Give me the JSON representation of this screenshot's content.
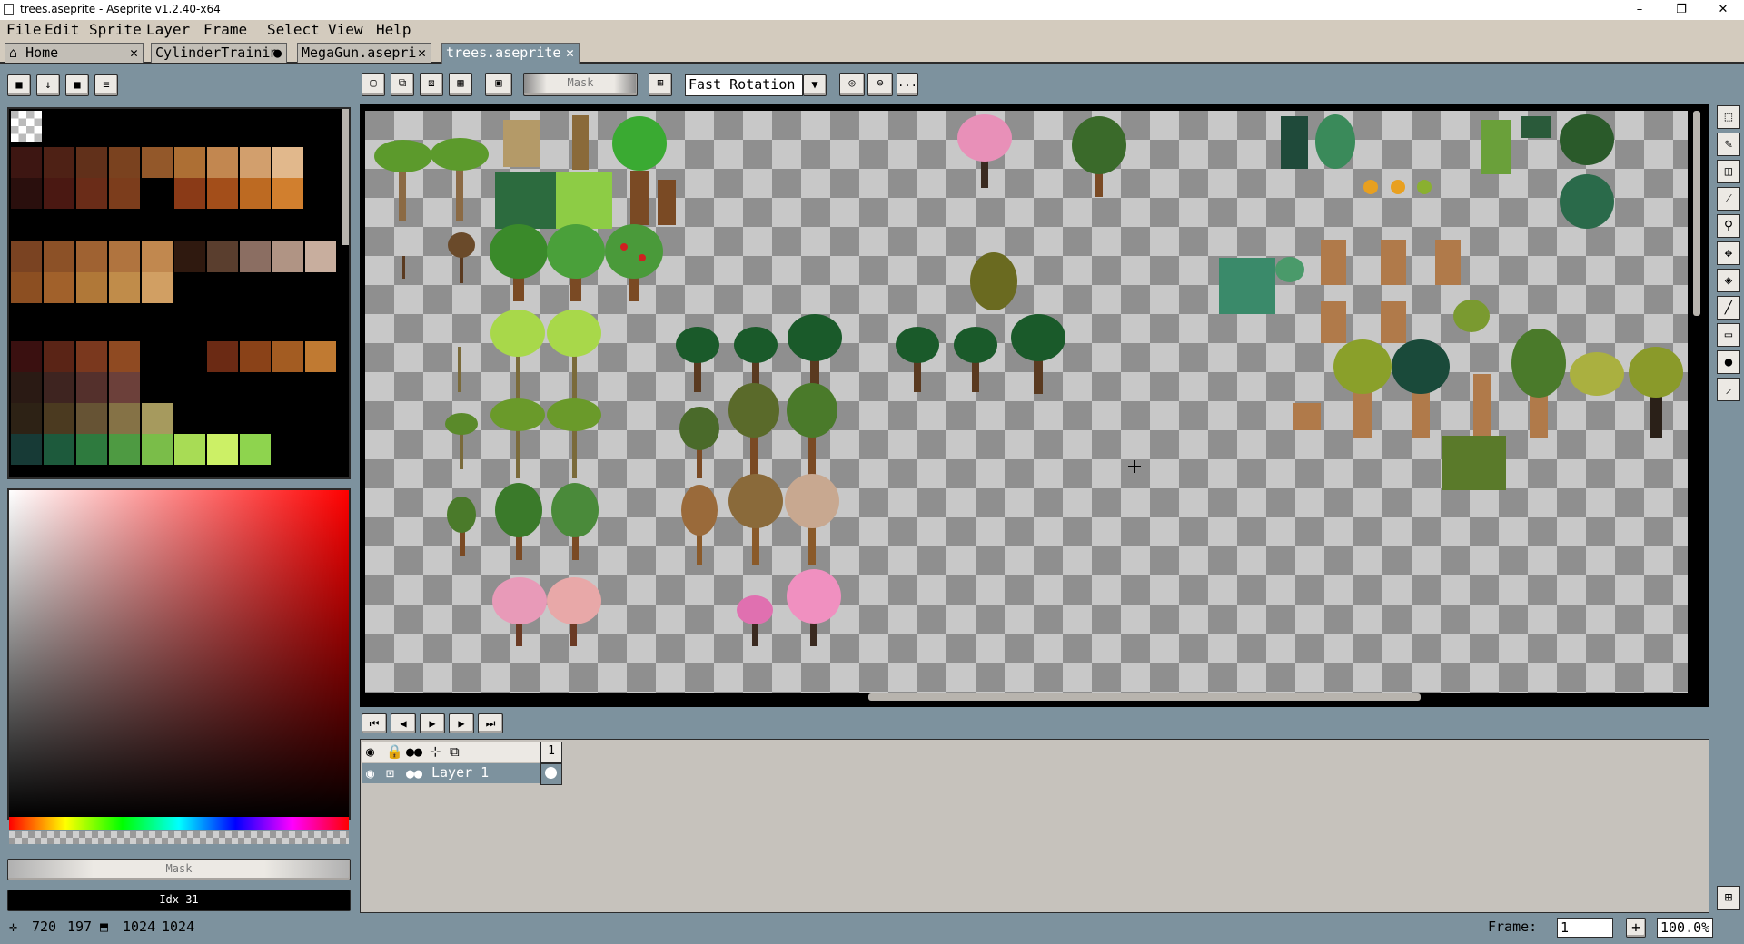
{
  "window": {
    "title": "trees.aseprite - Aseprite v1.2.40-x64",
    "minimize": "–",
    "maximize": "❐",
    "close": "✕"
  },
  "menu": [
    "File",
    "Edit",
    "Sprite",
    "Layer",
    "Frame",
    "Select",
    "View",
    "Help"
  ],
  "tabs": [
    {
      "label": "Home",
      "suffix": "✕",
      "icon": "home-icon"
    },
    {
      "label": "CylinderTrainin",
      "suffix": "●"
    },
    {
      "label": "MegaGun.asepri",
      "suffix": "✕"
    },
    {
      "label": "trees.aseprite",
      "suffix": "✕",
      "active": true
    }
  ],
  "palette_toolbar": [
    "lock-icon",
    "download-icon",
    "square-icon",
    "menu-icon"
  ],
  "context_bar": {
    "mask_label": "Mask",
    "rotation_algorithm": "Fast Rotation",
    "more": "..."
  },
  "palette_colors": [
    [
      "#3d1612",
      "#4e2115",
      "#61301a",
      "#7a421f",
      "#93582a",
      "#ad6f34",
      "#c28750",
      "#d29f6d",
      "#e1b88c"
    ],
    [
      "#2a0f0d",
      "#4a1812",
      "#6a2c18",
      "#7c3d1c",
      "#000000",
      "#8a3a17",
      "#a34e1a",
      "#bd6a22",
      "#d17f2e"
    ],
    [
      "#000000",
      "#000000",
      "#000000",
      "#000000",
      "#000000",
      "#000000",
      "#000000",
      "#000000",
      "#000000"
    ],
    [
      "#7a4322",
      "#8c5127",
      "#9f6232",
      "#b0743f",
      "#c1884f",
      "#2f190f",
      "#5a3e2e",
      "#8b6e62",
      "#b09484",
      "#c8ae9e"
    ],
    [
      "#8c4f22",
      "#a1612b",
      "#b07838",
      "#c08c4a",
      "#d19f63"
    ],
    [
      "#000000"
    ],
    [
      "#3a1010",
      "#5a2416",
      "#7a381e",
      "#8f4a22",
      "#000000",
      "#000000",
      "#6b2a14",
      "#8a4218",
      "#a35c22",
      "#c07a32"
    ],
    [
      "#2a1a14",
      "#3e2420",
      "#54302c",
      "#6c403a"
    ],
    [
      "#2d2215",
      "#4b3a20",
      "#665334",
      "#857246",
      "#a69a5e"
    ],
    [
      "#173a36",
      "#1d5a3c",
      "#2e7a3e",
      "#4e9a42",
      "#7abd49",
      "#a8dc55",
      "#ccf066",
      "#8ed44e"
    ]
  ],
  "color_bar": {
    "mask_label": "Mask",
    "index_label": "Idx-31"
  },
  "playback": [
    "first-frame-icon",
    "prev-frame-icon",
    "play-icon",
    "next-frame-icon",
    "last-frame-icon"
  ],
  "timeline": {
    "frame_number": "1",
    "layer_name": "Layer 1"
  },
  "status": {
    "cursor_x": "720",
    "cursor_y": "197",
    "size_w": "1024",
    "size_h": "1024",
    "frame_label": "Frame:",
    "frame_value": "1",
    "zoom": "100.0%",
    "plus": "+"
  },
  "tools": [
    "marquee-icon",
    "pencil-icon",
    "eraser-icon",
    "eyedropper-icon",
    "zoom-icon",
    "move-icon",
    "bucket-icon",
    "line-icon",
    "rectangle-icon",
    "blur-icon",
    "brush-icon"
  ],
  "colors": {
    "workspace": "#7d929e",
    "menu_bg": "#d3cbbe",
    "checker_light": "#c8c8c8",
    "checker_dark": "#8f8f8f"
  }
}
